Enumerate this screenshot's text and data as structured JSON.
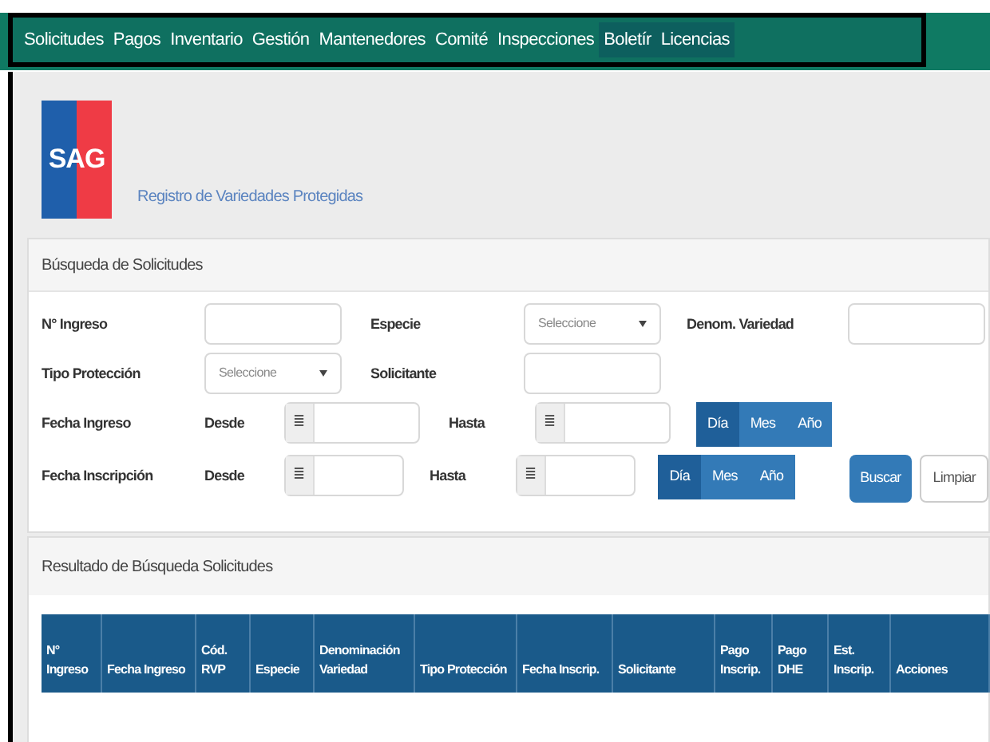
{
  "nav": {
    "items": [
      {
        "label": "Solicitudes",
        "selected": false
      },
      {
        "label": "Pagos",
        "selected": false
      },
      {
        "label": "Inventario",
        "selected": false
      },
      {
        "label": "Gestión",
        "selected": false
      },
      {
        "label": "Mantenedores",
        "selected": false
      },
      {
        "label": "Comité",
        "selected": false
      },
      {
        "label": "Inspecciones",
        "selected": false
      },
      {
        "label": "Boletír",
        "selected": true
      },
      {
        "label": "Licencias",
        "selected": true
      }
    ]
  },
  "header": {
    "logo": "SAG",
    "subtitle": "Registro de Variedades Protegidas"
  },
  "search_panel": {
    "title": "Búsqueda de Solicitudes",
    "row1": [
      {
        "label": "N° Ingreso",
        "kind": "text"
      },
      {
        "label": "Especie",
        "kind": "select",
        "placeholder": "Seleccione"
      },
      {
        "label": "Denom. Variedad",
        "kind": "text"
      }
    ],
    "row2": [
      {
        "label": "Tipo Protección",
        "kind": "select",
        "placeholder": "Seleccione"
      },
      {
        "label": "Solicitante",
        "kind": "text"
      }
    ],
    "date_rows": [
      {
        "label": "Fecha Ingreso",
        "from": "Desde",
        "to": "Hasta",
        "calendar_glyph": "≣",
        "periods": [
          {
            "label": "Día",
            "selected": true
          },
          {
            "label": "Mes",
            "selected": false
          },
          {
            "label": "Año",
            "selected": false
          }
        ]
      },
      {
        "label": "Fecha Inscripción",
        "from": "Desde",
        "to": "Hasta",
        "calendar_glyph": "≣",
        "periods": [
          {
            "label": "Día",
            "selected": true
          },
          {
            "label": "Mes",
            "selected": false
          },
          {
            "label": "Año",
            "selected": false
          }
        ]
      }
    ],
    "buttons": [
      {
        "label": "Buscar",
        "kind": "primary"
      },
      {
        "label": "Limpiar",
        "kind": "default"
      }
    ]
  },
  "results_panel": {
    "title": "Resultado de Búsqueda Solicitudes",
    "table": {
      "columns": [
        "N° Ingreso",
        "Fecha Ingreso",
        "Cód. RVP",
        "Especie",
        "Denominación Variedad",
        "Tipo Protección",
        "Fecha Inscrip.",
        "Solicitante",
        "Pago Inscrip.",
        "Pago DHE",
        "Est. Inscrip.",
        "Acciones"
      ]
    }
  }
}
